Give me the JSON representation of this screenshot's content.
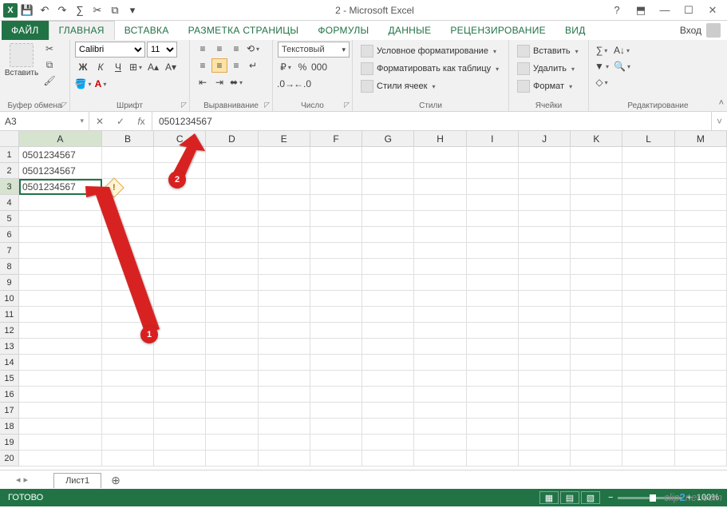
{
  "window": {
    "title": "2 - Microsoft Excel",
    "login": "Вход"
  },
  "qat": {
    "save": "💾",
    "undo": "↶",
    "redo": "↷",
    "sum": "∑",
    "cut": "✂",
    "copy": "⧉"
  },
  "tabs": {
    "file": "ФАЙЛ",
    "home": "ГЛАВНАЯ",
    "insert": "ВСТАВКА",
    "layout": "РАЗМЕТКА СТРАНИЦЫ",
    "formulas": "ФОРМУЛЫ",
    "data": "ДАННЫЕ",
    "review": "РЕЦЕНЗИРОВАНИЕ",
    "view": "ВИД"
  },
  "ribbon": {
    "clipboard": {
      "label": "Буфер обмена",
      "paste": "Вставить"
    },
    "font": {
      "label": "Шрифт",
      "name": "Calibri",
      "size": "11"
    },
    "alignment": {
      "label": "Выравнивание"
    },
    "number": {
      "label": "Число",
      "format": "Текстовый"
    },
    "styles": {
      "label": "Стили",
      "cond": "Условное форматирование",
      "table": "Форматировать как таблицу",
      "cell": "Стили ячеек"
    },
    "cells": {
      "label": "Ячейки",
      "insert": "Вставить",
      "delete": "Удалить",
      "format": "Формат"
    },
    "editing": {
      "label": "Редактирование"
    }
  },
  "namebox": "A3",
  "formula": "0501234567",
  "columns": [
    "A",
    "B",
    "C",
    "D",
    "E",
    "F",
    "G",
    "H",
    "I",
    "J",
    "K",
    "L",
    "M"
  ],
  "rows": [
    "1",
    "2",
    "3",
    "4",
    "5",
    "6",
    "7",
    "8",
    "9",
    "10",
    "11",
    "12",
    "13",
    "14",
    "15",
    "16",
    "17",
    "18",
    "19",
    "20"
  ],
  "cellA1": "0501234567",
  "cellA2": "0501234567",
  "cellA3": "0501234567",
  "sheet_tab": "Лист1",
  "status": "ГОТОВО",
  "zoom": "100%",
  "annot": {
    "b1": "1",
    "b2": "2"
  },
  "watermark": {
    "a": "clip",
    "b": "2",
    "c": "net",
    "d": ".com"
  }
}
